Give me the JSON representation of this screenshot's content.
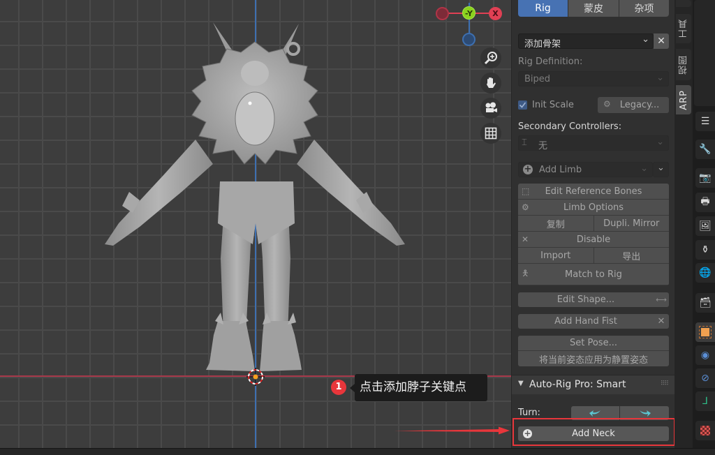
{
  "viewport": {
    "gizmo": {
      "neg_x_label": "",
      "y_label": "-Y",
      "x_label": "X",
      "z_label": ""
    },
    "nav": [
      {
        "name": "zoom-view-icon",
        "glyph": "⊕"
      },
      {
        "name": "pan-hand-icon",
        "glyph": "✋"
      },
      {
        "name": "camera-view-icon",
        "glyph": "🎥"
      },
      {
        "name": "ortho-grid-icon",
        "glyph": "▦"
      }
    ]
  },
  "annotation": {
    "step_number": "1",
    "tooltip_text": "点击添加脖子关键点"
  },
  "npanel": {
    "top_tabs": [
      "Rig",
      "蒙皮",
      "杂项"
    ],
    "active_top_tab": "Rig",
    "armature_field": {
      "value": "添加骨架",
      "chevron": "⌄",
      "clear": "✕"
    },
    "rig_definition": {
      "label": "Rig Definition:",
      "value": "Biped"
    },
    "init_scale": {
      "label": "Init Scale",
      "checked": true
    },
    "legacy_button": "Legacy...",
    "secondary_controllers": {
      "label": "Secondary Controllers:",
      "value": "无"
    },
    "add_limb": {
      "label": "Add Limb"
    },
    "limb_tools": {
      "edit_reference_bones": "Edit Reference Bones",
      "limb_options": "Limb Options",
      "copy": "复制",
      "dupli_mirror": "Dupli. Mirror",
      "disable": "Disable",
      "import": "Import",
      "export": "导出",
      "match_to_rig": "Match to Rig"
    },
    "edit_shape": "Edit Shape...",
    "add_hand_fist": "Add Hand Fist",
    "set_pose": "Set Pose...",
    "apply_pose_as_rest": "将当前姿态应用为静置姿态",
    "smart_panel": {
      "title": "Auto-Rig Pro: Smart",
      "turn_label": "Turn:",
      "add_neck": "Add Neck"
    }
  },
  "side_tabs": [
    "工具",
    "视图",
    "ARP"
  ],
  "active_side_tab": "ARP",
  "properties_tabs": [
    "tool",
    "render",
    "output",
    "view-layer",
    "scene",
    "world",
    "collection",
    "object",
    "physics",
    "constraints",
    "object-data",
    "texture"
  ],
  "colors": {
    "accent": "#4772b3",
    "annotation_red": "#e8363b",
    "axis_x": "#e04054",
    "axis_y": "#8bd21e",
    "axis_z": "#3d6fb0",
    "turn_arrows": "#5bc7d3"
  }
}
